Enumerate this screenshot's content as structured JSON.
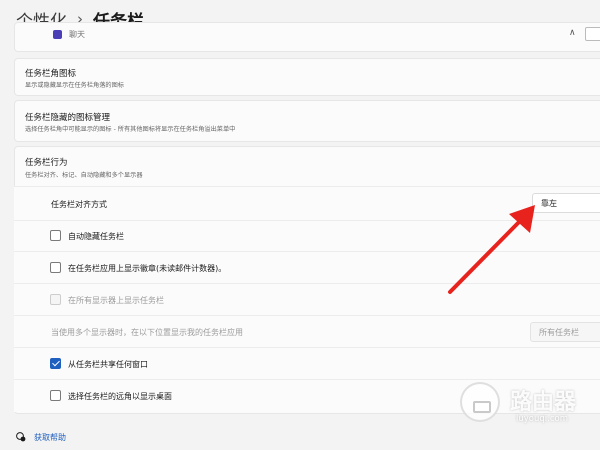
{
  "breadcrumb": {
    "parent": "个性化",
    "separator": "›",
    "current": "任务栏"
  },
  "cut_item": {
    "label": "聊天"
  },
  "cards": {
    "corner_icons": {
      "title": "任务栏角图标",
      "desc": "显示或隐藏显示在任务栏角落的图标"
    },
    "overflow": {
      "title": "任务栏隐藏的图标管理",
      "desc": "选择任务栏角中可能显示的图标 - 所有其他图标将显示在任务栏角溢出菜单中"
    },
    "behaviors": {
      "title": "任务栏行为",
      "desc": "任务栏对齐、标记、自动隐藏和多个显示器"
    }
  },
  "settings": {
    "alignment": {
      "label": "任务栏对齐方式",
      "value": "靠左"
    },
    "autohide": {
      "label": "自动隐藏任务栏",
      "checked": false
    },
    "badges": {
      "label": "在任务栏应用上显示徽章(未读邮件计数器)。",
      "checked": false
    },
    "all_displays": {
      "label": "在所有显示器上显示任务栏",
      "checked": false,
      "disabled": true
    },
    "multi_display": {
      "label": "当使用多个显示器时，在以下位置显示我的任务栏应用",
      "value": "所有任务栏",
      "disabled": true
    },
    "share_window": {
      "label": "从任务栏共享任何窗口",
      "checked": true
    },
    "corner_desktop": {
      "label": "选择任务栏的远角以显示桌面",
      "checked": false
    }
  },
  "help": {
    "label": "获取帮助"
  },
  "watermark": {
    "name": "路由器",
    "url": "luyouqi.com"
  },
  "colors": {
    "accent": "#1f5fbf",
    "annotation_arrow": "#e8231d"
  },
  "icons": [
    "chat-app-icon",
    "chevron-up-icon",
    "chevron-down-icon",
    "help-icon",
    "checkmark-icon"
  ]
}
